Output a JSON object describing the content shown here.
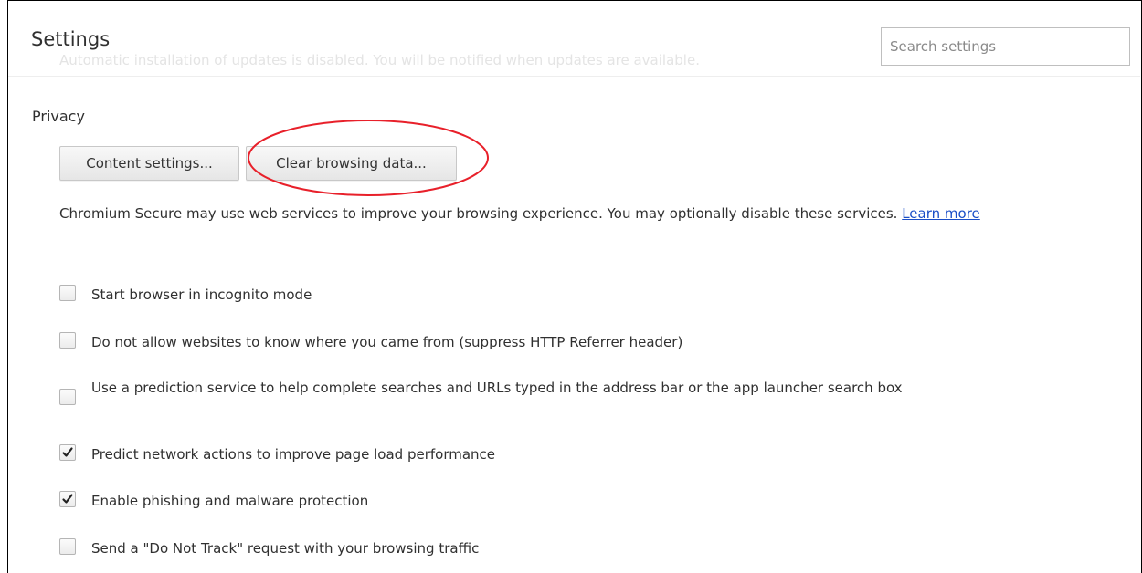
{
  "header": {
    "title": "Settings",
    "banner_text": "Automatic installation of updates is disabled. You will be notified when updates are available.",
    "search_placeholder": "Search settings"
  },
  "privacy": {
    "section_title": "Privacy",
    "content_settings_label": "Content settings...",
    "clear_browsing_data_label": "Clear browsing data...",
    "description": "Chromium Secure may use web services to improve your browsing experience. You may optionally disable these services.",
    "learn_more_label": "Learn more",
    "options": [
      {
        "label": "Start browser in incognito mode",
        "checked": false
      },
      {
        "label": "Do not allow websites to know where you came from (suppress HTTP Referrer header)",
        "checked": false
      },
      {
        "label": "Use a prediction service to help complete searches and URLs typed in the address bar or the app launcher search box",
        "checked": false
      },
      {
        "label": "Predict network actions to improve page load performance",
        "checked": true
      },
      {
        "label": "Enable phishing and malware protection",
        "checked": true
      },
      {
        "label": "Send a \"Do Not Track\" request with your browsing traffic",
        "checked": false
      }
    ]
  },
  "colors": {
    "highlight_ring": "#e8202a",
    "link": "#1a4ec7",
    "text": "#303030"
  }
}
